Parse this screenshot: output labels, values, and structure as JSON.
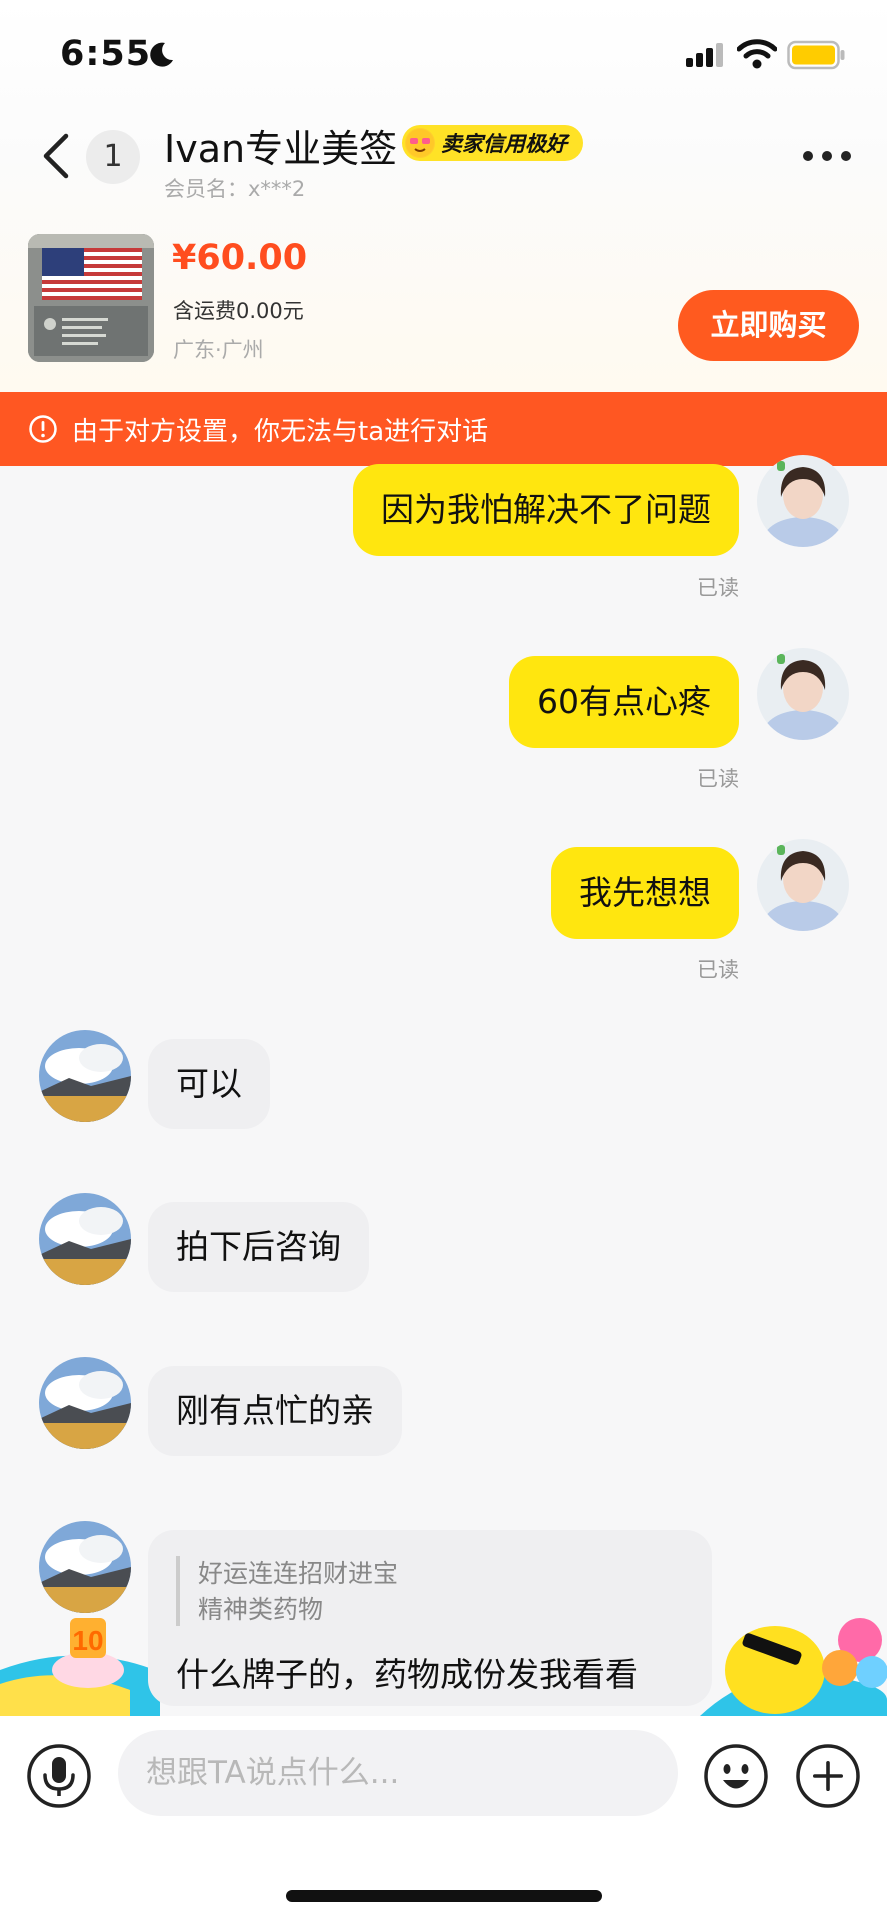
{
  "status_bar": {
    "time": "6:55"
  },
  "header": {
    "unread_count": "1",
    "shop_name": "Ivan专业美签",
    "credit_badge": "卖家信用极好",
    "member_label": "会员名：x***2"
  },
  "product": {
    "price": "¥60.00",
    "shipping": "含运费0.00元",
    "location": "广东·广州",
    "buy_label": "立即购买"
  },
  "warning": {
    "text": "由于对方设置，你无法与ta进行对话"
  },
  "messages": {
    "out": [
      {
        "text": "因为我怕解决不了问题",
        "status": "已读"
      },
      {
        "text": "60有点心疼",
        "status": "已读"
      },
      {
        "text": "我先想想",
        "status": "已读"
      }
    ],
    "in": [
      {
        "text": "可以"
      },
      {
        "text": "拍下后咨询"
      },
      {
        "text": "刚有点忙的亲"
      }
    ],
    "quoted": {
      "quote_line1": "好运连连招财进宝",
      "quote_line2": "精神类药物",
      "text": "什么牌子的，药物成份发我看看"
    }
  },
  "input": {
    "placeholder": "想跟TA说点什么..."
  },
  "colors": {
    "accent": "#ff5a1f",
    "warning": "#ff5722",
    "bubble_out": "#ffe60f",
    "bubble_in": "#efeff1",
    "price": "#ff4d1f"
  }
}
